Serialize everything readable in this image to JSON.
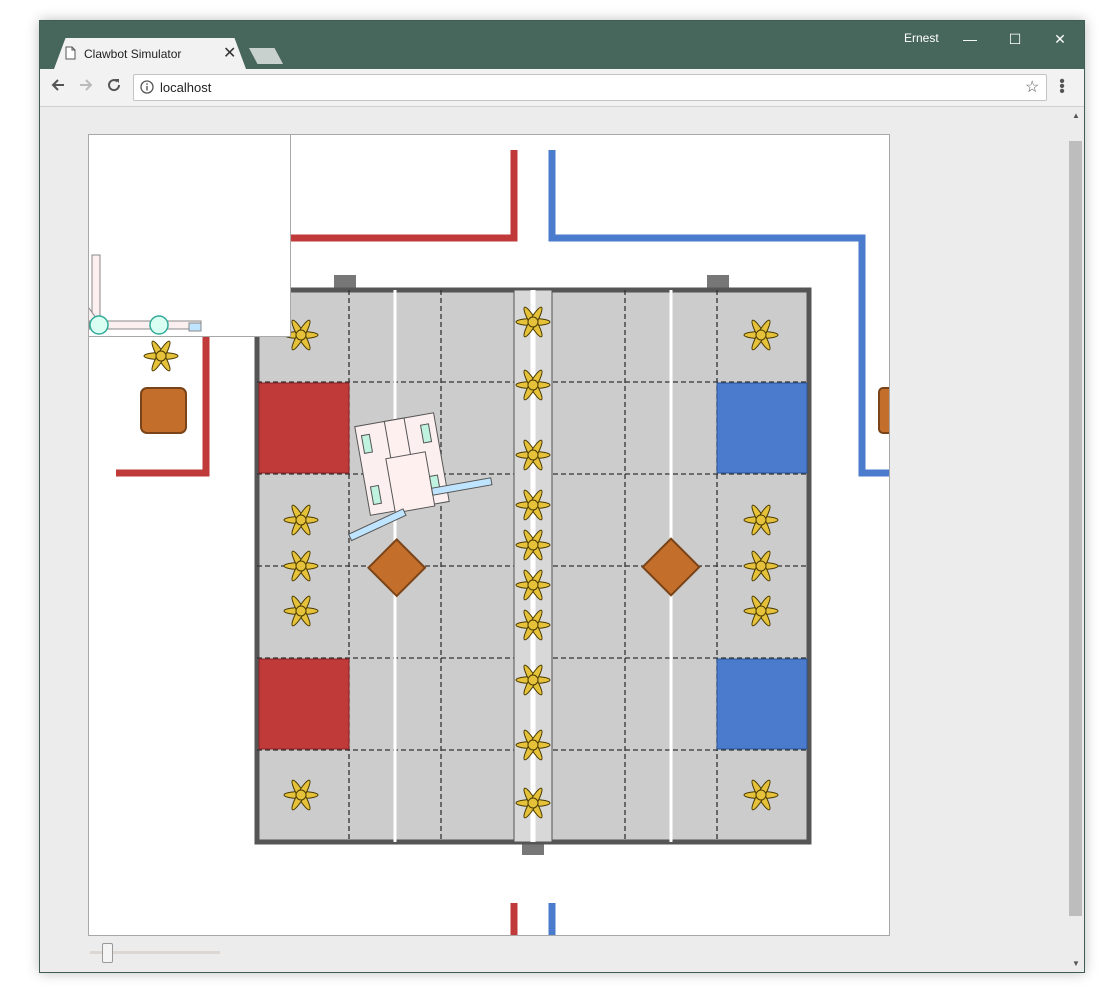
{
  "browser": {
    "tab_title": "Clawbot Simulator",
    "tab_close": "✕",
    "user_name": "Ernest",
    "window_controls": {
      "minimize": "—",
      "maximize": "☐",
      "close": "✕"
    },
    "url": "localhost",
    "icons": [
      "page-icon",
      "back-arrow-icon",
      "forward-arrow-icon",
      "reload-icon",
      "info-icon",
      "star-icon",
      "menu-icon"
    ]
  },
  "simulator": {
    "field_colors": {
      "red": "#c03a3a",
      "blue": "#4a7bcc",
      "tile": "#cccccc",
      "cube": "#c46e2c",
      "star": "#e5c23a"
    },
    "zoom_slider": {
      "value_fraction": 0.12
    }
  }
}
